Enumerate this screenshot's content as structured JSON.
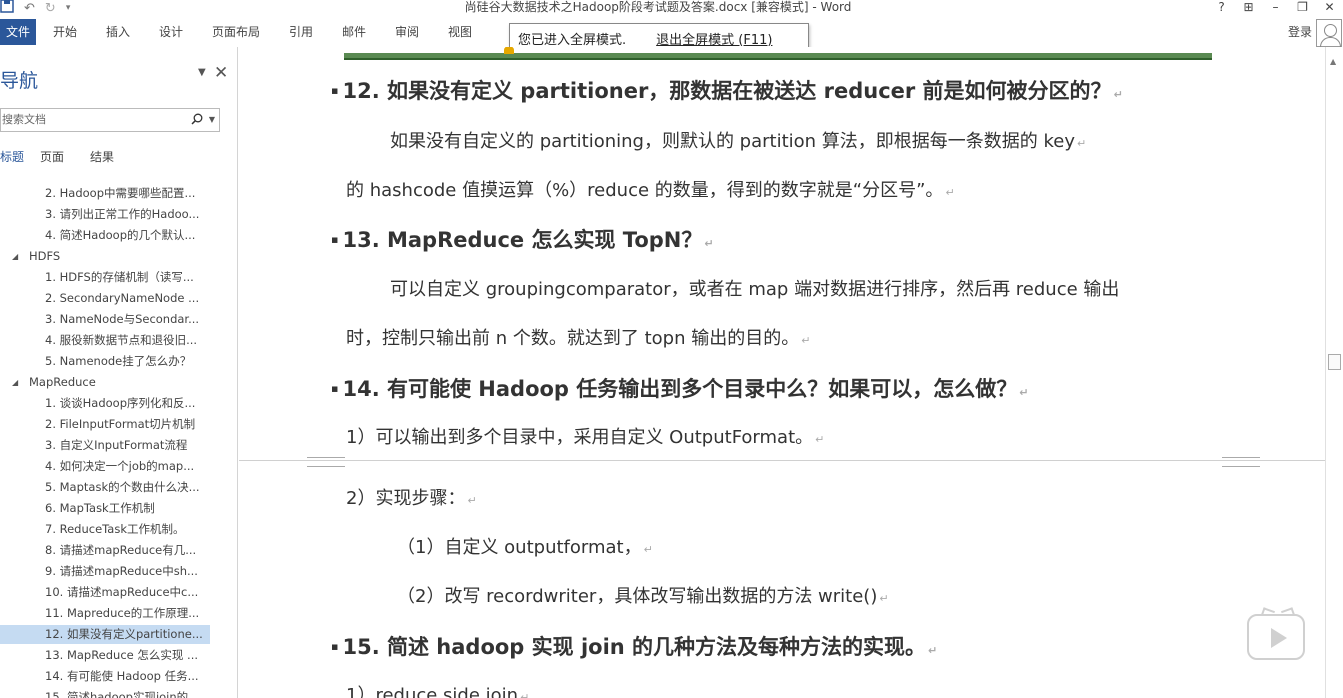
{
  "window": {
    "title": "尚硅谷大数据技术之Hadoop阶段考试题及答案.docx [兼容模式] - Word",
    "help": "?",
    "controls": [
      "?",
      "⊞",
      "–",
      "❐",
      "✕"
    ]
  },
  "ribbon": {
    "tabs": [
      "文件",
      "开始",
      "插入",
      "设计",
      "页面布局",
      "引用",
      "邮件",
      "审阅",
      "视图"
    ],
    "login": "登录"
  },
  "fullscreen_tip": {
    "message": "您已进入全屏模式.",
    "exit_link": "退出全屏模式 (F11)"
  },
  "nav": {
    "title": "导航",
    "search_placeholder": "搜索文档",
    "tabs": [
      "标题",
      "页面",
      "结果"
    ],
    "items": [
      {
        "label": "2. Hadoop中需要哪些配置...",
        "level": 2
      },
      {
        "label": "3. 请列出正常工作的Hadoo...",
        "level": 2
      },
      {
        "label": "4. 简述Hadoop的几个默认...",
        "level": 2
      },
      {
        "label": "HDFS",
        "level": 1
      },
      {
        "label": "1. HDFS的存储机制（读写...",
        "level": 2
      },
      {
        "label": "2. SecondaryNameNode ...",
        "level": 2
      },
      {
        "label": "3. NameNode与Secondar...",
        "level": 2
      },
      {
        "label": "4. 服役新数据节点和退役旧...",
        "level": 2
      },
      {
        "label": "5. Namenode挂了怎么办？",
        "level": 2
      },
      {
        "label": "MapReduce",
        "level": 1
      },
      {
        "label": "1. 谈谈Hadoop序列化和反...",
        "level": 2
      },
      {
        "label": "2. FileInputFormat切片机制",
        "level": 2
      },
      {
        "label": "3. 自定义InputFormat流程",
        "level": 2
      },
      {
        "label": "4. 如何决定一个job的map...",
        "level": 2
      },
      {
        "label": "5. Maptask的个数由什么决...",
        "level": 2
      },
      {
        "label": "6. MapTask工作机制",
        "level": 2
      },
      {
        "label": "7. ReduceTask工作机制。",
        "level": 2
      },
      {
        "label": "8. 请描述mapReduce有几...",
        "level": 2
      },
      {
        "label": "9. 请描述mapReduce中sh...",
        "level": 2
      },
      {
        "label": "10. 请描述mapReduce中c...",
        "level": 2
      },
      {
        "label": "11. Mapreduce的工作原理...",
        "level": 2
      },
      {
        "label": "12. 如果没有定义partitione...",
        "level": 2
      },
      {
        "label": "13. MapReduce 怎么实现 ...",
        "level": 2
      },
      {
        "label": "14. 有可能使 Hadoop 任务...",
        "level": 2
      },
      {
        "label": "15. 简述hadoop实现join的...",
        "level": 2
      }
    ],
    "selected_index": 21
  },
  "document": {
    "paragraphs": [
      {
        "kind": "heading",
        "text": "12. 如果没有定义 partitioner，那数据在被送达 reducer 前是如何被分区的？"
      },
      {
        "kind": "body",
        "text": "如果没有自定义的 partitioning，则默认的 partition 算法，即根据每一条数据的 key"
      },
      {
        "kind": "body",
        "text": "的 hashcode 值摸运算（%）reduce 的数量，得到的数字就是“分区号”。"
      },
      {
        "kind": "heading",
        "text": "13. MapReduce 怎么实现 TopN？"
      },
      {
        "kind": "body",
        "text": "可以自定义 groupingcomparator，或者在 map 端对数据进行排序，然后再 reduce 输出"
      },
      {
        "kind": "body",
        "text": "时，控制只输出前 n 个数。就达到了 topn 输出的目的。"
      },
      {
        "kind": "heading",
        "text": "14. 有可能使 Hadoop 任务输出到多个目录中么？如果可以，怎么做？"
      },
      {
        "kind": "body",
        "text": "1）可以输出到多个目录中，采用自定义 OutputFormat。"
      },
      {
        "kind": "body",
        "text": "2）实现步骤："
      },
      {
        "kind": "body",
        "text": "（1）自定义 outputformat，"
      },
      {
        "kind": "body",
        "text": "（2）改写 recordwriter，具体改写输出数据的方法 write()"
      },
      {
        "kind": "heading",
        "text": "15. 简述 hadoop 实现 join 的几种方法及每种方法的实现。"
      },
      {
        "kind": "body",
        "text": "1）reduce side join"
      }
    ],
    "para_mark": "↵",
    "bullet": "▪"
  },
  "colors": {
    "accent": "#2b579a",
    "selected": "#c5dbf2"
  }
}
